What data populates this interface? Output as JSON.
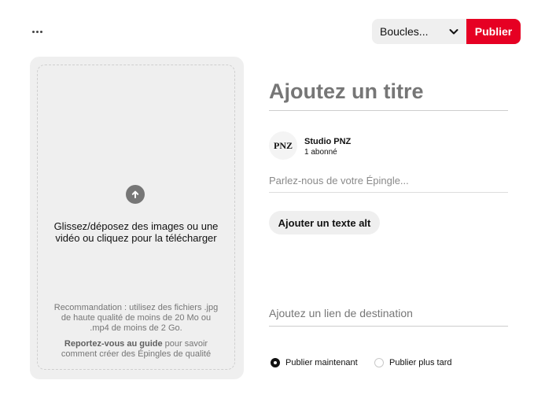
{
  "toolbar": {
    "more_icon": "more-horizontal-icon",
    "board_select_value": "Boucles...",
    "publish_label": "Publier",
    "accent_color": "#e60023"
  },
  "upload": {
    "icon": "arrow-up-circle-icon",
    "main_text": "Glissez/déposez des images ou une vidéo ou cliquez pour la télécharger",
    "hint_text": "Recommandation : utilisez des fichiers .jpg de haute qualité de moins de 20 Mo ou .mp4 de moins de 2 Go.",
    "guide_link": "Reportez-vous au guide",
    "guide_rest": " pour savoir comment créer des Épingles de qualité"
  },
  "form": {
    "title_placeholder": "Ajoutez un titre",
    "user": {
      "avatar_text": "PNZ",
      "name": "Studio PNZ",
      "followers": "1 abonné"
    },
    "description_placeholder": "Parlez-nous de votre Épingle...",
    "alt_text_button": "Ajouter un texte alt",
    "link_placeholder": "Ajoutez un lien de destination",
    "publish_options": [
      {
        "label": "Publier maintenant",
        "selected": true
      },
      {
        "label": "Publier plus tard",
        "selected": false
      }
    ]
  }
}
